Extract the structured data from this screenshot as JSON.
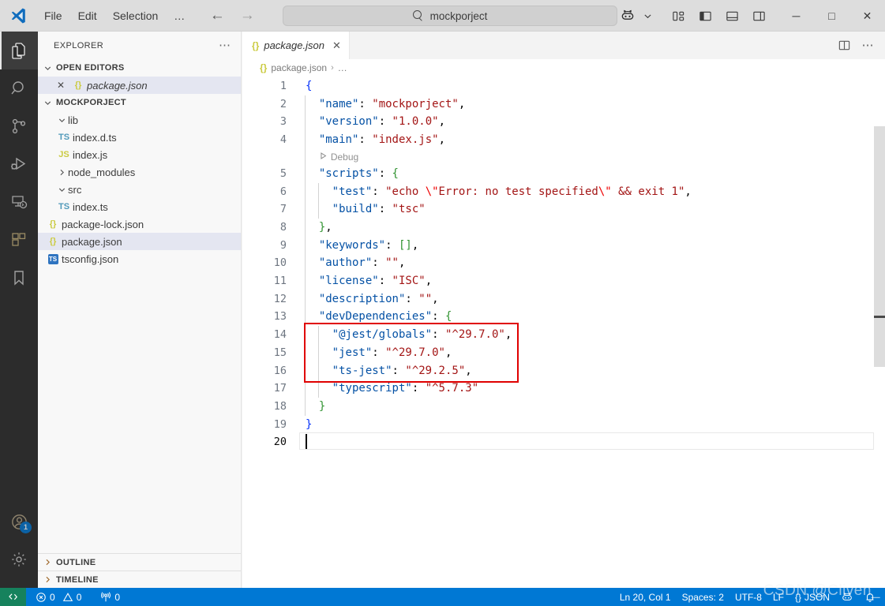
{
  "titlebar": {
    "logo_icon": "vscode-logo-icon",
    "menu": [
      "File",
      "Edit",
      "Selection",
      "…"
    ],
    "nav_back_icon": "arrow-left-icon",
    "nav_forward_icon": "arrow-right-icon",
    "search_value": "mockporject",
    "search_icon": "search-icon",
    "copilot_icon": "copilot-icon",
    "copilot_chevron": "chevron-down-icon",
    "layout_icons": [
      "customize-layout-icon",
      "toggle-primary-sidebar-icon",
      "toggle-panel-icon",
      "toggle-secondary-sidebar-icon"
    ],
    "window_controls": {
      "minimize": "─",
      "maximize": "□",
      "close": "✕"
    }
  },
  "activitybar": {
    "items": [
      {
        "name": "explorer",
        "icon": "files-icon",
        "active": true,
        "badge": null
      },
      {
        "name": "search",
        "icon": "search-icon",
        "active": false,
        "badge": null
      },
      {
        "name": "source-control",
        "icon": "source-control-icon",
        "active": false,
        "badge": null
      },
      {
        "name": "run-and-debug",
        "icon": "run-debug-icon",
        "active": false,
        "badge": null
      },
      {
        "name": "remote-explorer",
        "icon": "remote-explorer-icon",
        "active": false,
        "badge": null
      },
      {
        "name": "extensions",
        "icon": "extensions-icon",
        "active": false,
        "badge": null
      },
      {
        "name": "bookmarks",
        "icon": "bookmark-icon",
        "active": false,
        "badge": null
      }
    ],
    "bottom": [
      {
        "name": "accounts",
        "icon": "account-icon",
        "badge": "1"
      },
      {
        "name": "manage",
        "icon": "gear-icon",
        "badge": null
      }
    ]
  },
  "sidebar": {
    "title": "EXPLORER",
    "more_actions_icon": "ellipsis-icon",
    "open_editors": {
      "label": "OPEN EDITORS",
      "expanded": true,
      "items": [
        {
          "name": "package.json",
          "icon": "json-icon",
          "close_icon": "close-icon",
          "selected": true
        }
      ]
    },
    "project": {
      "label": "MOCKPORJECT",
      "expanded": true,
      "items": [
        {
          "name": "lib",
          "type": "folder",
          "expanded": true,
          "depth": 1,
          "icon": "chevron-down-icon"
        },
        {
          "name": "index.d.ts",
          "type": "file",
          "depth": 2,
          "icon": "ts-icon"
        },
        {
          "name": "index.js",
          "type": "file",
          "depth": 2,
          "icon": "js-icon"
        },
        {
          "name": "node_modules",
          "type": "folder",
          "expanded": false,
          "depth": 1,
          "icon": "chevron-right-icon"
        },
        {
          "name": "src",
          "type": "folder",
          "expanded": true,
          "depth": 1,
          "icon": "chevron-down-icon"
        },
        {
          "name": "index.ts",
          "type": "file",
          "depth": 2,
          "icon": "ts-icon"
        },
        {
          "name": "package-lock.json",
          "type": "file",
          "depth": 1,
          "icon": "json-icon"
        },
        {
          "name": "package.json",
          "type": "file",
          "depth": 1,
          "icon": "json-icon",
          "selected": true
        },
        {
          "name": "tsconfig.json",
          "type": "file",
          "depth": 1,
          "icon": "tsconfig-icon"
        }
      ]
    },
    "outline": {
      "label": "OUTLINE",
      "expanded": false
    },
    "timeline": {
      "label": "TIMELINE",
      "expanded": false
    }
  },
  "editor": {
    "tab": {
      "label": "package.json",
      "icon": "json-icon",
      "close_icon": "close-icon",
      "dirty": false
    },
    "tab_actions": [
      "split-editor-icon",
      "more-actions-icon"
    ],
    "breadcrumb": {
      "icon": "json-icon",
      "file": "package.json",
      "separator": "›",
      "tail": "…"
    },
    "codelens": {
      "icon": "play-icon",
      "label": "Debug",
      "line": 4
    },
    "lines": [
      {
        "n": 1,
        "indent": 0,
        "tokens": [
          {
            "t": "{",
            "c": "br1"
          }
        ]
      },
      {
        "n": 2,
        "indent": 1,
        "tokens": [
          {
            "t": "\"name\"",
            "c": "k"
          },
          {
            "t": ": ",
            "c": "p"
          },
          {
            "t": "\"mockporject\"",
            "c": "s"
          },
          {
            "t": ",",
            "c": "p"
          }
        ]
      },
      {
        "n": 3,
        "indent": 1,
        "tokens": [
          {
            "t": "\"version\"",
            "c": "k"
          },
          {
            "t": ": ",
            "c": "p"
          },
          {
            "t": "\"1.0.0\"",
            "c": "s"
          },
          {
            "t": ",",
            "c": "p"
          }
        ]
      },
      {
        "n": 4,
        "indent": 1,
        "tokens": [
          {
            "t": "\"main\"",
            "c": "k"
          },
          {
            "t": ": ",
            "c": "p"
          },
          {
            "t": "\"index.js\"",
            "c": "s"
          },
          {
            "t": ",",
            "c": "p"
          }
        ]
      },
      {
        "n": 5,
        "indent": 1,
        "tokens": [
          {
            "t": "\"scripts\"",
            "c": "k"
          },
          {
            "t": ": ",
            "c": "p"
          },
          {
            "t": "{",
            "c": "br2"
          }
        ]
      },
      {
        "n": 6,
        "indent": 2,
        "tokens": [
          {
            "t": "\"test\"",
            "c": "k"
          },
          {
            "t": ": ",
            "c": "p"
          },
          {
            "t": "\"echo ",
            "c": "s"
          },
          {
            "t": "\\\"",
            "c": "esc"
          },
          {
            "t": "Error: no test specified",
            "c": "s"
          },
          {
            "t": "\\\"",
            "c": "esc"
          },
          {
            "t": " && exit 1\"",
            "c": "s"
          },
          {
            "t": ",",
            "c": "p"
          }
        ]
      },
      {
        "n": 7,
        "indent": 2,
        "tokens": [
          {
            "t": "\"build\"",
            "c": "k"
          },
          {
            "t": ": ",
            "c": "p"
          },
          {
            "t": "\"tsc\"",
            "c": "s"
          }
        ]
      },
      {
        "n": 8,
        "indent": 1,
        "tokens": [
          {
            "t": "}",
            "c": "br2"
          },
          {
            "t": ",",
            "c": "p"
          }
        ]
      },
      {
        "n": 9,
        "indent": 1,
        "tokens": [
          {
            "t": "\"keywords\"",
            "c": "k"
          },
          {
            "t": ": ",
            "c": "p"
          },
          {
            "t": "[]",
            "c": "br2"
          },
          {
            "t": ",",
            "c": "p"
          }
        ]
      },
      {
        "n": 10,
        "indent": 1,
        "tokens": [
          {
            "t": "\"author\"",
            "c": "k"
          },
          {
            "t": ": ",
            "c": "p"
          },
          {
            "t": "\"\"",
            "c": "s"
          },
          {
            "t": ",",
            "c": "p"
          }
        ]
      },
      {
        "n": 11,
        "indent": 1,
        "tokens": [
          {
            "t": "\"license\"",
            "c": "k"
          },
          {
            "t": ": ",
            "c": "p"
          },
          {
            "t": "\"ISC\"",
            "c": "s"
          },
          {
            "t": ",",
            "c": "p"
          }
        ]
      },
      {
        "n": 12,
        "indent": 1,
        "tokens": [
          {
            "t": "\"description\"",
            "c": "k"
          },
          {
            "t": ": ",
            "c": "p"
          },
          {
            "t": "\"\"",
            "c": "s"
          },
          {
            "t": ",",
            "c": "p"
          }
        ]
      },
      {
        "n": 13,
        "indent": 1,
        "tokens": [
          {
            "t": "\"devDependencies\"",
            "c": "k"
          },
          {
            "t": ": ",
            "c": "p"
          },
          {
            "t": "{",
            "c": "br2"
          }
        ]
      },
      {
        "n": 14,
        "indent": 2,
        "tokens": [
          {
            "t": "\"@jest/globals\"",
            "c": "k"
          },
          {
            "t": ": ",
            "c": "p"
          },
          {
            "t": "\"^29.7.0\"",
            "c": "s"
          },
          {
            "t": ",",
            "c": "p"
          }
        ]
      },
      {
        "n": 15,
        "indent": 2,
        "tokens": [
          {
            "t": "\"jest\"",
            "c": "k"
          },
          {
            "t": ": ",
            "c": "p"
          },
          {
            "t": "\"^29.7.0\"",
            "c": "s"
          },
          {
            "t": ",",
            "c": "p"
          }
        ]
      },
      {
        "n": 16,
        "indent": 2,
        "tokens": [
          {
            "t": "\"ts-jest\"",
            "c": "k"
          },
          {
            "t": ": ",
            "c": "p"
          },
          {
            "t": "\"^29.2.5\"",
            "c": "s"
          },
          {
            "t": ",",
            "c": "p"
          }
        ]
      },
      {
        "n": 17,
        "indent": 2,
        "tokens": [
          {
            "t": "\"typescript\"",
            "c": "k"
          },
          {
            "t": ": ",
            "c": "p"
          },
          {
            "t": "\"^5.7.3\"",
            "c": "s"
          }
        ]
      },
      {
        "n": 18,
        "indent": 1,
        "tokens": [
          {
            "t": "}",
            "c": "br2"
          }
        ]
      },
      {
        "n": 19,
        "indent": 0,
        "tokens": [
          {
            "t": "}",
            "c": "br1"
          }
        ]
      },
      {
        "n": 20,
        "indent": 0,
        "tokens": []
      }
    ],
    "annotation": {
      "name": "red-highlight-box",
      "covers_lines": [
        14,
        15,
        16
      ],
      "color": "#e00000"
    },
    "cursor": {
      "line": 20,
      "column": 1
    }
  },
  "statusbar": {
    "remote_icon": "remote-window-icon",
    "problems": {
      "error_icon": "error-icon",
      "errors": "0",
      "warning_icon": "warning-icon",
      "warnings": "0"
    },
    "ports": {
      "icon": "radio-tower-icon",
      "count": "0"
    },
    "position": "Ln 20, Col 1",
    "indentation": "Spaces: 2",
    "encoding": "UTF-8",
    "eol": "LF",
    "language": {
      "icon": "json-icon",
      "label": "JSON"
    },
    "copilot_icon": "copilot-icon",
    "bell_icon": "bell-icon"
  },
  "watermark": "CSDN @Cliven_"
}
